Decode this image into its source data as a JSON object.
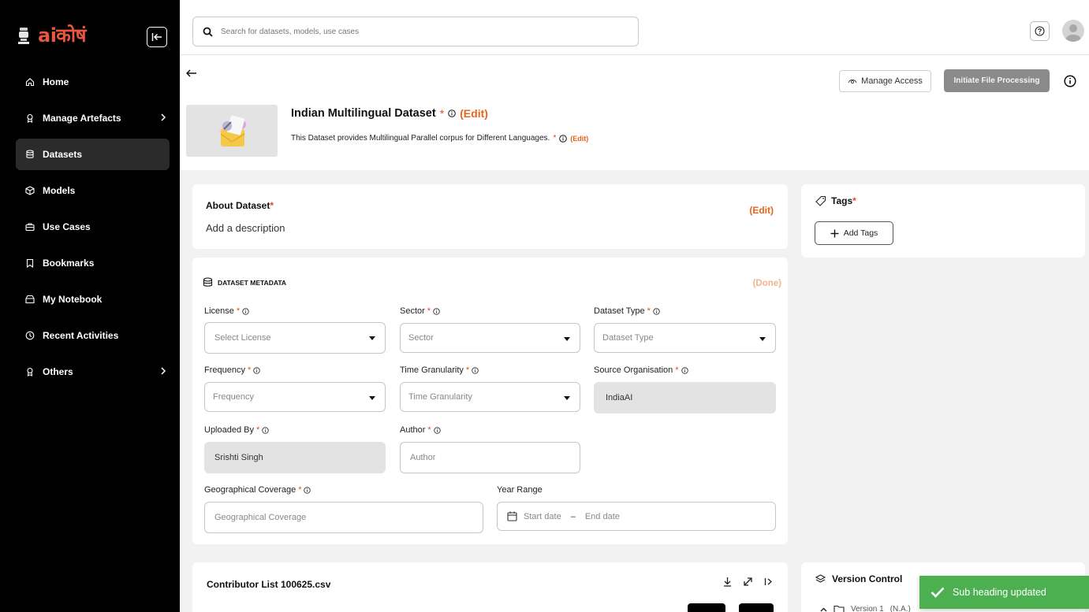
{
  "sidebar": {
    "brand": "aiकोषं",
    "items": [
      {
        "label": "Home",
        "icon": "home-icon"
      },
      {
        "label": "Manage Artefacts",
        "icon": "award-icon",
        "chevron": true
      },
      {
        "label": "Datasets",
        "icon": "database-icon",
        "active": true
      },
      {
        "label": "Models",
        "icon": "box-icon"
      },
      {
        "label": "Use Cases",
        "icon": "briefcase-icon"
      },
      {
        "label": "Bookmarks",
        "icon": "bookmark-icon"
      },
      {
        "label": "My Notebook",
        "icon": "notebook-icon"
      },
      {
        "label": "Recent Activities",
        "icon": "clock-icon"
      },
      {
        "label": "Others",
        "icon": "award-icon",
        "chevron": true
      }
    ]
  },
  "header": {
    "search_placeholder": "Search for datasets, models, use cases"
  },
  "page": {
    "manage_access_label": "Manage Access",
    "initiate_label": "Initiate File Processing",
    "title": "Indian Multilingual Dataset",
    "required_mark": "*",
    "edit_label": "(Edit)",
    "subtitle": "This Dataset provides Multilingual Parallel corpus for Different Languages."
  },
  "about": {
    "heading": "About Dataset",
    "required_mark": "*",
    "edit_label": "(Edit)",
    "description": "Add a description"
  },
  "tags": {
    "heading": "Tags",
    "required_mark": "*",
    "add_label": "Add Tags"
  },
  "metadata": {
    "heading": "DATASET METADATA",
    "done_label": "(Done)",
    "fields": {
      "license": {
        "label": "License",
        "placeholder": "Select License"
      },
      "sector": {
        "label": "Sector",
        "placeholder": "Sector"
      },
      "dataset_type": {
        "label": "Dataset Type",
        "placeholder": "Dataset Type"
      },
      "frequency": {
        "label": "Frequency",
        "placeholder": "Frequency"
      },
      "time_granularity": {
        "label": "Time Granularity",
        "placeholder": "Time Granularity"
      },
      "source_org": {
        "label": "Source Organisation",
        "value": "IndiaAI"
      },
      "uploaded_by": {
        "label": "Uploaded By",
        "value": "Srishti Singh"
      },
      "author": {
        "label": "Author",
        "placeholder": "Author"
      },
      "geo": {
        "label": "Geographical Coverage",
        "placeholder": "Geographical Coverage"
      },
      "year_range": {
        "label": "Year Range",
        "start_placeholder": "Start date",
        "separator": "–",
        "end_placeholder": "End date"
      }
    },
    "required_mark": "*"
  },
  "contributor": {
    "title": "Contributor List 100625.csv"
  },
  "version_control": {
    "heading": "Version Control",
    "version_label": "Version 1",
    "version_note": "(N.A.)"
  },
  "toast": {
    "message": "Sub heading updated"
  },
  "colors": {
    "accent_orange": "#e8631d",
    "required_red": "#e04b1a",
    "toast_green": "#4caf50",
    "sidebar_bg": "#000000"
  }
}
